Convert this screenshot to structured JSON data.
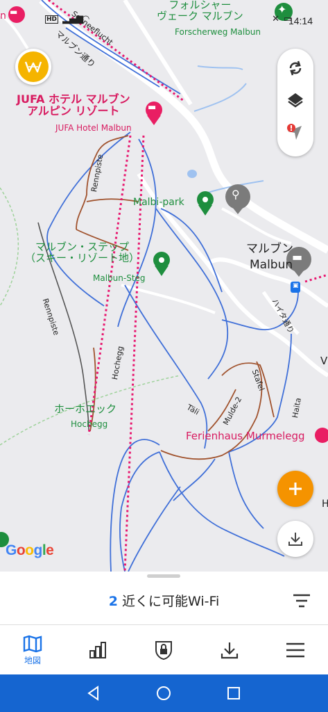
{
  "status_bar": {
    "time": "14:14",
    "network": "HD"
  },
  "map": {
    "poi_labels": [
      {
        "id": "jufa-ja",
        "text": "JUFA ホテル マルブン\nアルピン リゾート",
        "color": "pink"
      },
      {
        "id": "jufa-en",
        "text": "JUFA Hotel Malbun",
        "color": "pink"
      },
      {
        "id": "forscher-ja",
        "text": "フォルシャー\nヴェーク マルブン",
        "color": "green"
      },
      {
        "id": "forscher-en",
        "text": "Forscherweg Malbun",
        "color": "green"
      },
      {
        "id": "malbipark",
        "text": "Malbi-park",
        "color": "green"
      },
      {
        "id": "steg-ja",
        "text": "マルブン・ステップ\n（スキー・リゾート地）",
        "color": "green"
      },
      {
        "id": "steg-en",
        "text": "Malbun-Steg",
        "color": "green"
      },
      {
        "id": "malbun-ja",
        "text": "マルブン",
        "color": "dark"
      },
      {
        "id": "malbun-en",
        "text": "Malbun",
        "color": "dark"
      },
      {
        "id": "hochegg-ja",
        "text": "ホーホエック",
        "color": "green"
      },
      {
        "id": "hochegg-en",
        "text": "Hochegg",
        "color": "green"
      },
      {
        "id": "ferienhaus",
        "text": "Ferienhaus Murmelegg",
        "color": "pink"
      }
    ],
    "road_labels": {
      "schneeflucht": "Schneeflucht",
      "malbun_street": "マルブン通り",
      "rennpiste_top": "Rennpiste",
      "rennpiste_bottom": "Rennpiste",
      "hochegg_road": "Hochegg",
      "haita_street": "ハイタ通り",
      "tali": "Täli",
      "mulde": "Mulde-2",
      "stafel": "Stafel",
      "haita": "Haita"
    },
    "edge_fragments": {
      "left_top": "n",
      "right_v": "V",
      "right_h": "H"
    },
    "google_logo": {
      "G": "G",
      "o1": "o",
      "o2": "o",
      "g": "g",
      "l": "l",
      "e": "e"
    },
    "logo_badge_icon": "wifi-map-logo-icon",
    "colors": {
      "pink": "#d81b60",
      "green": "#1e8e3e",
      "dark": "#222222",
      "accent": "#1a73e8",
      "fab": "#f59300"
    }
  },
  "side_controls": [
    "refresh-icon",
    "layers-icon",
    "location-warning-icon"
  ],
  "bottom_sheet": {
    "count": "2",
    "label": "近くに可能Wi-Fi"
  },
  "bottom_nav": [
    {
      "icon": "map-icon",
      "label": "地図",
      "active": true
    },
    {
      "icon": "bar-chart-icon",
      "label": ""
    },
    {
      "icon": "lock-icon",
      "label": ""
    },
    {
      "icon": "download-icon",
      "label": ""
    },
    {
      "icon": "menu-icon",
      "label": ""
    }
  ],
  "system_nav": [
    "back-icon",
    "home-icon",
    "recents-icon"
  ]
}
